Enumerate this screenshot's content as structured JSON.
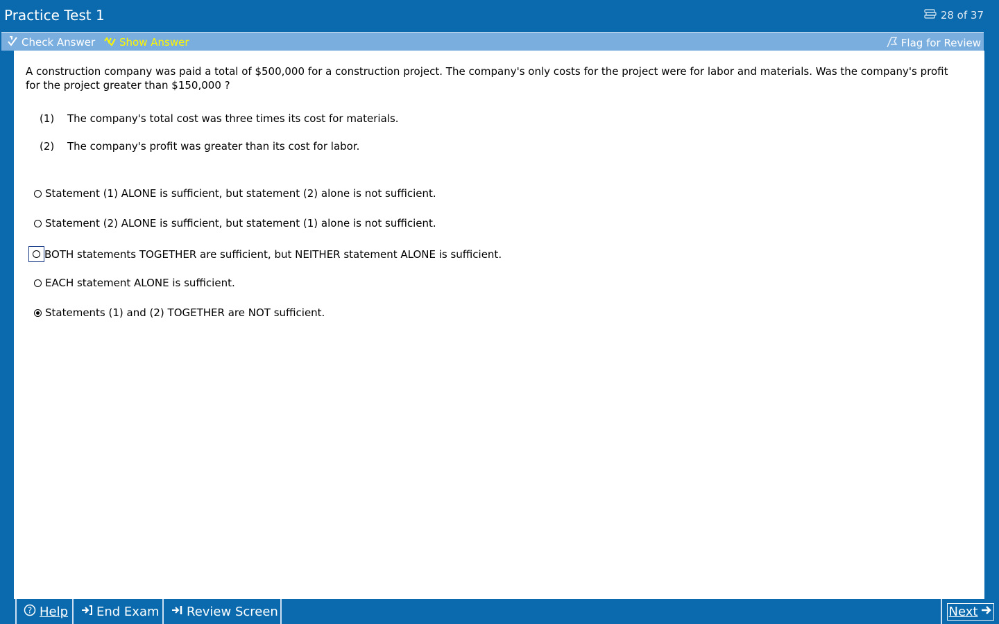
{
  "window": {
    "title": "Practice Test 1",
    "progress": "28 of 37"
  },
  "toolbar": {
    "check_answer": "Check Answer",
    "show_answer": "Show Answer",
    "flag_review": "Flag for Review"
  },
  "question": {
    "text": "A construction company was paid a total of $500,000 for a construction project.  The company's only costs for the project were for labor and materials.  Was the company's profit for the project greater than $150,000 ?",
    "statements": [
      {
        "num": "(1)",
        "text": "The company's total cost was three times its cost for materials."
      },
      {
        "num": "(2)",
        "text": "The company's profit was greater than its cost for labor."
      }
    ]
  },
  "choices": [
    {
      "text": "Statement (1) ALONE is sufficient, but statement (2) alone is not sufficient.",
      "selected": false
    },
    {
      "text": "Statement (2) ALONE is sufficient, but statement (1) alone is not sufficient.",
      "selected": false
    },
    {
      "text": "BOTH statements TOGETHER are sufficient, but NEITHER statement ALONE is sufficient.",
      "selected": false
    },
    {
      "text": "EACH statement ALONE is sufficient.",
      "selected": false
    },
    {
      "text": "Statements (1) and (2) TOGETHER are NOT sufficient.",
      "selected": true
    }
  ],
  "bottom": {
    "help": "Help",
    "end_exam": "End Exam",
    "review_screen": "Review Screen",
    "next": "Next"
  },
  "colors": {
    "frame": "#0a6aad",
    "toolbar": "#7aaedf",
    "show_answer": "#fff600"
  }
}
